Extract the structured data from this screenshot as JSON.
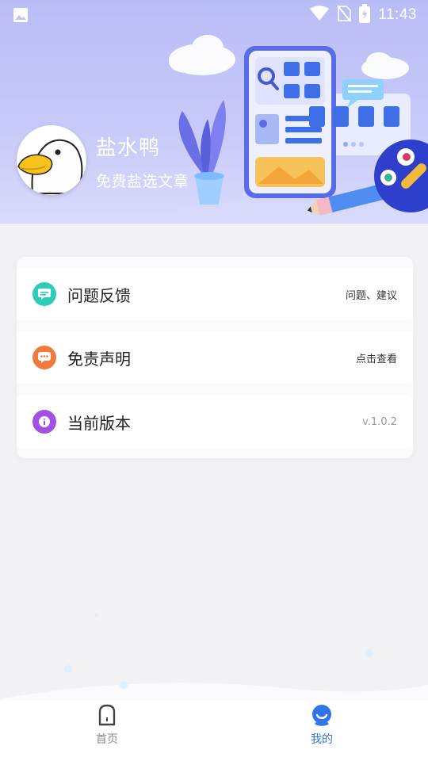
{
  "status_bar": {
    "time": "11:43",
    "icons": [
      "image-icon",
      "wifi-icon",
      "no-sim-icon",
      "battery-charging-icon"
    ]
  },
  "profile": {
    "name": "盐水鸭",
    "subtitle": "免费盐选文章"
  },
  "menu": {
    "items": [
      {
        "label": "问题反馈",
        "value": "问题、建议",
        "icon": "feedback-icon",
        "color": "#2ccdb8"
      },
      {
        "label": "免责声明",
        "value": "点击查看",
        "icon": "disclaimer-icon",
        "color": "#f07a3c"
      },
      {
        "label": "当前版本",
        "value": "v.1.0.2",
        "icon": "info-icon",
        "color": "#a34fe6"
      }
    ]
  },
  "tabbar": {
    "tabs": [
      {
        "label": "首页",
        "icon": "home-icon",
        "active": false
      },
      {
        "label": "我的",
        "icon": "profile-icon",
        "active": true
      }
    ],
    "active_color": "#2f74e8",
    "inactive_color": "#8a8a8a"
  }
}
